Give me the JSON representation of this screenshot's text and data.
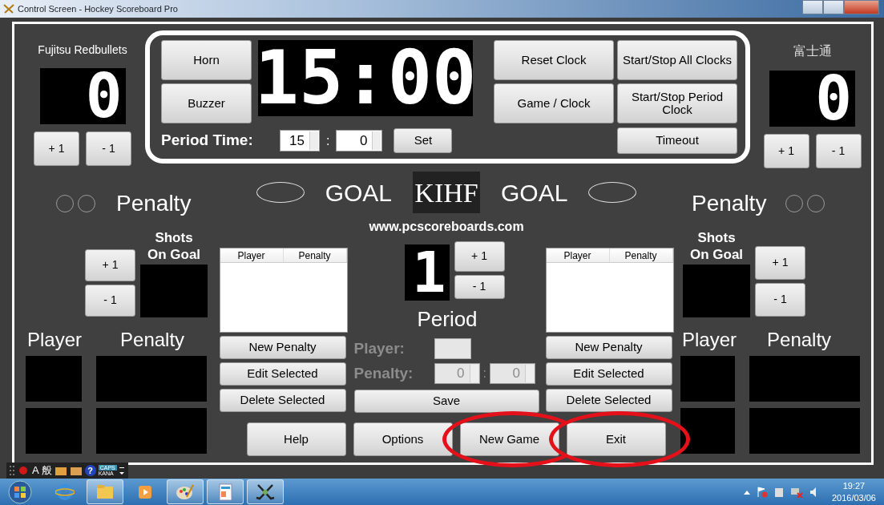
{
  "window": {
    "title": "Control Screen - Hockey Scoreboard Pro"
  },
  "teams": [
    {
      "name": "Fujitsu Redbullets",
      "score": "0",
      "score_buttons": [
        "+ 1",
        "- 1"
      ],
      "penalty_label": "Penalty",
      "shots_label": "Shots On Goal",
      "shots_buttons": [
        "+ 1",
        "- 1"
      ],
      "player_header": "Player",
      "penalty_header": "Penalty"
    },
    {
      "name": "富士通",
      "score": "0",
      "score_buttons": [
        "+ 1",
        "- 1"
      ],
      "penalty_label": "Penalty",
      "shots_label": "Shots On Goal",
      "shots_buttons": [
        "+ 1",
        "- 1"
      ],
      "player_header": "Player",
      "penalty_header": "Penalty"
    }
  ],
  "clock": {
    "time": "15:00",
    "left_buttons": [
      "Horn",
      "Buzzer"
    ],
    "right_buttons": [
      "Reset Clock",
      "Start/Stop All Clocks",
      "Game / Clock",
      "Start/Stop Period Clock",
      "Timeout"
    ],
    "period_time_label": "Period Time:",
    "minutes": "15",
    "separator": ":",
    "seconds": "0",
    "set_button": "Set"
  },
  "goal_labels": [
    "GOAL",
    "GOAL"
  ],
  "logo": "KIHF",
  "url": "www.pcscoreboards.com",
  "period": {
    "value": "1",
    "buttons": [
      "+ 1",
      "- 1"
    ],
    "label": "Period"
  },
  "penalty_lists": [
    {
      "columns": [
        "Player",
        "Penalty"
      ],
      "buttons": [
        "New Penalty",
        "Edit Selected",
        "Delete Selected"
      ]
    },
    {
      "columns": [
        "Player",
        "Penalty"
      ],
      "buttons": [
        "New Penalty",
        "Edit Selected",
        "Delete Selected"
      ]
    }
  ],
  "penalty_form": {
    "disabled": true,
    "player_label": "Player:",
    "penalty_label": "Penalty:",
    "minutes": "0",
    "separator": ":",
    "seconds": "0",
    "save_button": "Save"
  },
  "bottom_buttons": [
    {
      "label": "Help",
      "circled": false
    },
    {
      "label": "Options",
      "circled": false
    },
    {
      "label": "New Game",
      "circled": true
    },
    {
      "label": "Exit",
      "circled": true
    }
  ],
  "language_bar": {
    "mode": "A",
    "ime": "般",
    "help": "?",
    "caps": "CAPS",
    "kana": "KANA"
  },
  "taskbar": {
    "apps": [
      {
        "kind": "browser",
        "running": false
      },
      {
        "kind": "folder",
        "running": true
      },
      {
        "kind": "media",
        "running": false
      },
      {
        "kind": "paint",
        "running": true
      },
      {
        "kind": "document",
        "running": true
      },
      {
        "kind": "hockey",
        "running": true
      }
    ],
    "time": "19:27",
    "date": "2016/03/06"
  }
}
